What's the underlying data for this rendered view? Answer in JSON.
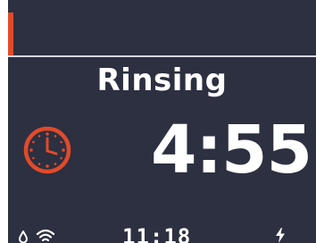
{
  "program": {
    "status_label": "Rinsing",
    "time_remaining": "4:55"
  },
  "status_bar": {
    "clock_time": "11:18",
    "icons": [
      "water-drop-icon",
      "wifi-icon",
      "power-bolt-icon"
    ]
  },
  "colors": {
    "background": "#2c3040",
    "accent": "#e24a2a",
    "text": "#ffffff"
  }
}
